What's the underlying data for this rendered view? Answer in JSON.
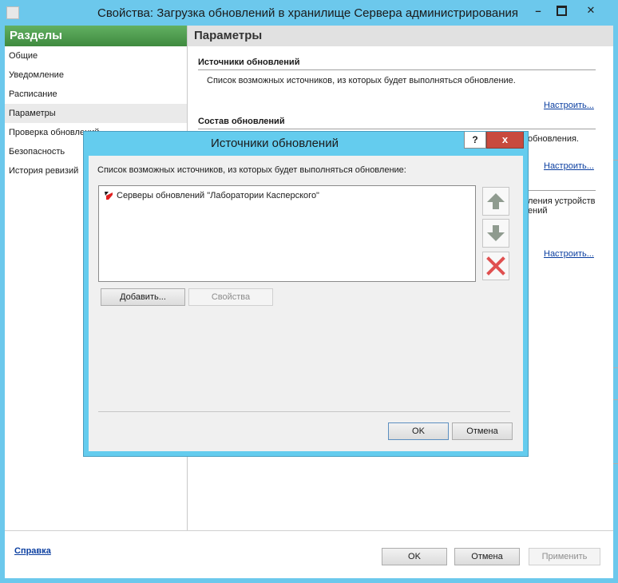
{
  "window": {
    "title": "Свойства: Загрузка обновлений в хранилище Сервера администрирования",
    "minimize_symbol": "–",
    "maximize_symbol": "□",
    "close_symbol": "✕"
  },
  "sidebar": {
    "header": "Разделы",
    "items": [
      {
        "label": "Общие"
      },
      {
        "label": "Уведомление"
      },
      {
        "label": "Расписание"
      },
      {
        "label": "Параметры",
        "selected": true
      },
      {
        "label": "Проверка обновлений"
      },
      {
        "label": "Безопасность"
      },
      {
        "label": "История ревизий"
      }
    ],
    "help_link": "Справка"
  },
  "params": {
    "header": "Параметры",
    "sections": [
      {
        "title": "Источники обновлений",
        "description": "Список возможных источников, из которых будет выполняться обновление.",
        "link": "Настроить..."
      },
      {
        "title": "Состав обновлений",
        "description": "обновления.",
        "link": "Настроить..."
      },
      {
        "title": "",
        "description": "ления устройств",
        "description2": "ений",
        "link": "Настроить..."
      }
    ]
  },
  "footer": {
    "ok": "OK",
    "cancel": "Отмена",
    "apply": "Применить"
  },
  "dialog": {
    "title": "Источники обновлений",
    "help_symbol": "?",
    "close_symbol": "x",
    "description": "Список возможных источников, из которых будет выполняться обновление:",
    "sources": [
      {
        "label": "Серверы обновлений \"Лаборатории Касперского\"",
        "icon": "kaspersky-icon"
      }
    ],
    "add_button": "Добавить...",
    "properties_button": "Свойства",
    "ok": "OK",
    "cancel": "Отмена",
    "icons": {
      "up": "arrow-up-icon",
      "down": "arrow-down-icon",
      "delete": "delete-icon"
    },
    "colors": {
      "arrow": "#8f9b8f",
      "delete": "#e05050",
      "title_bar": "#64ccee",
      "close": "#c84a3e"
    }
  }
}
